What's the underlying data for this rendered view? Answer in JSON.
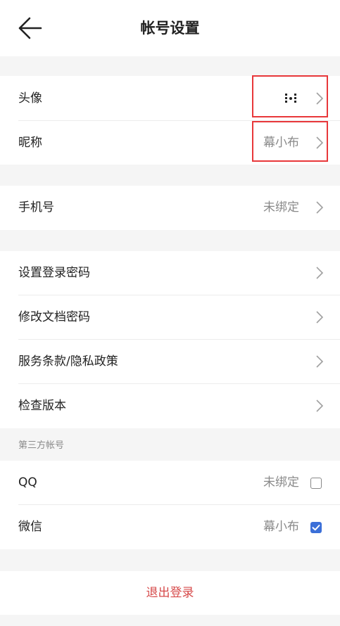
{
  "header": {
    "title": "帐号设置"
  },
  "profile": {
    "avatar_label": "头像",
    "nickname_label": "昵称",
    "nickname_value": "幕小布"
  },
  "phone": {
    "label": "手机号",
    "value": "未绑定"
  },
  "menu": {
    "set_login_password": "设置登录密码",
    "change_doc_password": "修改文档密码",
    "terms_privacy": "服务条款/隐私政策",
    "check_version": "检查版本"
  },
  "third_party": {
    "section_title": "第三方帐号",
    "qq_label": "QQ",
    "qq_value": "未绑定",
    "qq_checked": false,
    "wechat_label": "微信",
    "wechat_value": "幕小布",
    "wechat_checked": true
  },
  "logout": {
    "label": "退出登录"
  },
  "colors": {
    "highlight_red": "#e8373a",
    "checkbox_blue": "#3b6fd8",
    "logout_red": "#d64a4a"
  }
}
